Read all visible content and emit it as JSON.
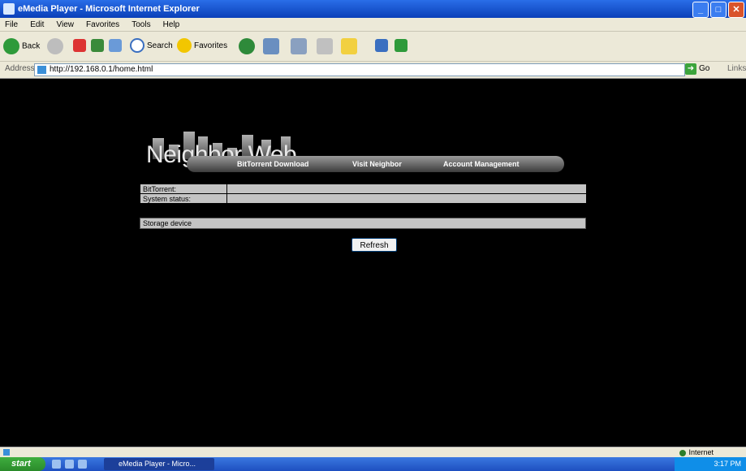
{
  "window": {
    "title": "eMedia Player - Microsoft Internet Explorer",
    "buttons": {
      "minimize": "_",
      "maximize": "□",
      "close": "✕"
    }
  },
  "menu": [
    "File",
    "Edit",
    "View",
    "Favorites",
    "Tools",
    "Help"
  ],
  "toolbar": {
    "back": "Back",
    "search": "Search",
    "favorites": "Favorites"
  },
  "address": {
    "label": "Address",
    "url": "http://192.168.0.1/home.html",
    "go": "Go",
    "links": "Links"
  },
  "page": {
    "logo_text": "Neighbor Web",
    "nav": [
      {
        "label": "BitTorrent Download"
      },
      {
        "label": "Visit Neighbor"
      },
      {
        "label": "Account Management"
      }
    ],
    "status_rows": [
      {
        "key": "BitTorrent:",
        "value": ""
      },
      {
        "key": "System status:",
        "value": ""
      }
    ],
    "storage_label": "Storage device",
    "refresh_label": "Refresh"
  },
  "statusbar": {
    "zone": "Internet"
  },
  "taskbar": {
    "start": "start",
    "task": "eMedia Player - Micro...",
    "clock": "3:17 PM"
  },
  "colors": {
    "content_bg": "#000000",
    "row_bg": "#c4c4c4",
    "title_blue": "#0a3fb8"
  }
}
